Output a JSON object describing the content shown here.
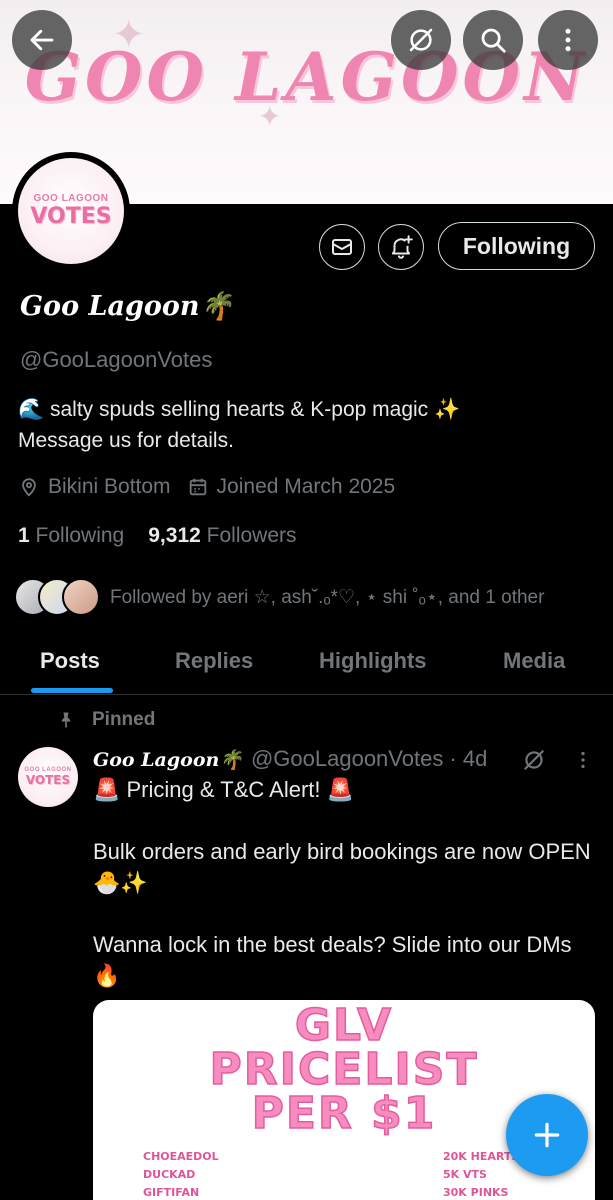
{
  "banner": {
    "title": "GOO LAGOON"
  },
  "avatar": {
    "small_text": "GOO LAGOON",
    "big_text": "VOTES"
  },
  "profile": {
    "following_label": "Following",
    "display_name": "Goo Lagoon🌴",
    "handle": "@GooLagoonVotes",
    "bio_line1": "🌊 salty spuds selling hearts & K-pop magic ✨",
    "bio_line2": "Message us for details.",
    "location": "Bikini Bottom",
    "joined": "Joined March 2025",
    "following_count": "1",
    "following_label_text": "Following",
    "followers_count": "9,312",
    "followers_label_text": "Followers",
    "followed_by": "Followed by aeri ☆, ash˘.ₒ*♡, ⋆ shi ˚ₒ⋆, and 1 other"
  },
  "tabs": [
    {
      "label": "Posts",
      "active": true
    },
    {
      "label": "Replies",
      "active": false
    },
    {
      "label": "Highlights",
      "active": false
    },
    {
      "label": "Media",
      "active": false
    }
  ],
  "pinned_tweet": {
    "pinned_label": "Pinned",
    "name": "Goo Lagoon🌴",
    "handle_time": "@GooLagoonVotes · 4d",
    "line1": "🚨 Pricing & T&C Alert! 🚨",
    "line2": "Bulk orders and early bird bookings are now OPEN 🐣✨",
    "line3": "Wanna lock in the best deals? Slide into our DMs 🔥",
    "card": {
      "title1": "GLV",
      "title2": "PRICELIST",
      "title3": "PER $1",
      "left_items": [
        "CHOEAEDOL",
        "DUCKAD",
        "GIFTIFAN"
      ],
      "right_items": [
        "20K HEARTS",
        "5K VTS",
        "30K PINKS"
      ]
    }
  },
  "colors": {
    "accent": "#1d9bf0",
    "banner_pink": "#ef85b1",
    "muted": "#71767b"
  },
  "icons": [
    "back-arrow-icon",
    "grok-icon",
    "search-icon",
    "more-vertical-icon",
    "mail-icon",
    "bell-plus-icon",
    "location-pin-icon",
    "calendar-icon",
    "pin-icon",
    "plus-icon"
  ]
}
